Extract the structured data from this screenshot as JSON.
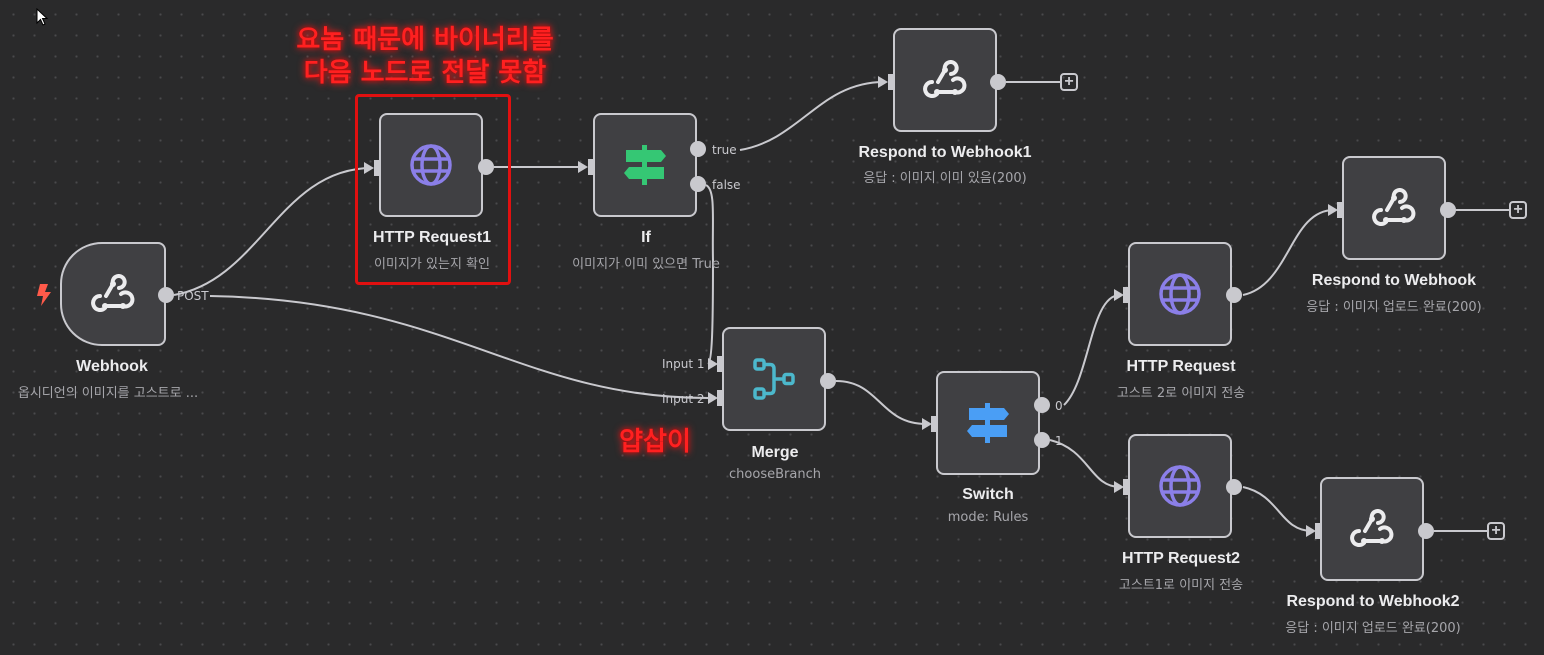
{
  "canvas": {
    "background": "#2a2a2b",
    "edge_color": "#c9c9ce"
  },
  "annotations": {
    "top_note_line1": "요놈 때문에 바이너리를",
    "top_note_line2": "다음 노드로 전달 못함",
    "merge_note": "얍삽이",
    "annotation_color": "#ff2020"
  },
  "nodes": {
    "webhook": {
      "title": "Webhook",
      "subtitle": "옵시디언의 이미지를 고스트로 ...",
      "icon": "webhook-icon",
      "trigger_icon": "lightning-bolt-icon",
      "output_label": "POST"
    },
    "http_request1": {
      "title": "HTTP Request1",
      "subtitle": "이미지가 있는지 확인",
      "icon": "globe-icon"
    },
    "if": {
      "title": "If",
      "subtitle": "이미지가 이미 있으면 True",
      "icon": "signpost-icon",
      "outputs": [
        "true",
        "false"
      ]
    },
    "respond1": {
      "title": "Respond to Webhook1",
      "subtitle": "응답 : 이미지 이미 있음(200)",
      "icon": "webhook-icon"
    },
    "merge": {
      "title": "Merge",
      "subtitle": "chooseBranch",
      "icon": "merge-icon",
      "inputs": [
        "Input 1",
        "Input 2"
      ]
    },
    "switch": {
      "title": "Switch",
      "subtitle": "mode: Rules",
      "icon": "signpost-icon",
      "outputs": [
        "0",
        "1"
      ]
    },
    "http_request": {
      "title": "HTTP Request",
      "subtitle": "고스트 2로 이미지 전송",
      "icon": "globe-icon"
    },
    "respond": {
      "title": "Respond to Webhook",
      "subtitle": "응답 : 이미지 업로드 완료(200)",
      "icon": "webhook-icon"
    },
    "http_request2": {
      "title": "HTTP Request2",
      "subtitle": "고스트1로 이미지 전송",
      "icon": "globe-icon"
    },
    "respond2": {
      "title": "Respond to Webhook2",
      "subtitle": "응답 : 이미지 업로드 완료(200)",
      "icon": "webhook-icon"
    }
  },
  "add_button_label": "+",
  "icon_colors": {
    "globe": "#8b7fe8",
    "if_signpost": "#35c774",
    "switch_signpost": "#4a9ef5",
    "merge": "#4cb8cc",
    "webhook": "#ececee",
    "trigger_bolt": "#ff5a4a"
  }
}
